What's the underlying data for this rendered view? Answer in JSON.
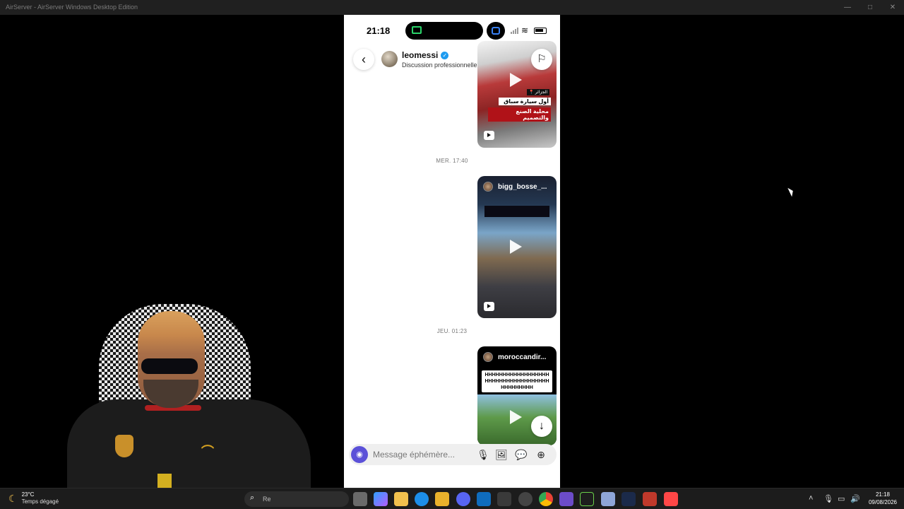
{
  "window": {
    "title": "AirServer - AirServer Windows Desktop Edition",
    "controls": [
      "—",
      "□",
      "✕"
    ]
  },
  "phone": {
    "status": {
      "time": "21:18",
      "wifi_icon": "wifi-icon",
      "battery_icon": "battery-icon"
    },
    "header": {
      "back_icon": "‹",
      "username": "leomessi",
      "verified_icon": "✓",
      "subtitle": "Discussion professionnelle",
      "flag_icon": "⚐"
    },
    "messages": [
      {
        "type": "reel",
        "overlay_location": "📍 الجزائر",
        "overlay_line1": "أول سيارة سباق",
        "overlay_line2": "محلية الصنع والتصميم"
      },
      {
        "type": "timestamp",
        "text": "MER. 17:40"
      },
      {
        "type": "reel",
        "user": "bigg_bosse_..."
      },
      {
        "type": "timestamp",
        "text": "JEU. 01:23"
      },
      {
        "type": "reel",
        "user": "moroccandir...",
        "caption": "HHHHHHHHHHHHHHHHHHHHHHHHHHHHHHHHHHHHHHHHHHHHH"
      }
    ],
    "scroll_down_icon": "↓",
    "composer": {
      "camera_icon": "◉",
      "placeholder": "Message éphémère...",
      "mic_icon": "🎙",
      "image_icon": "🖼",
      "sticker_icon": "💬",
      "add_icon": "⊕"
    }
  },
  "taskbar": {
    "weather_temp": "23°C",
    "weather_desc": "Temps dégagé",
    "search_text": "Re",
    "clock_time": "21:18",
    "clock_date": "09/08/2026",
    "colors": {
      "accent": "#5b51d8",
      "chat_bg": "#ffffff",
      "taskbar_bg": "#1c1c1c",
      "verified": "#1d9bf0"
    }
  }
}
